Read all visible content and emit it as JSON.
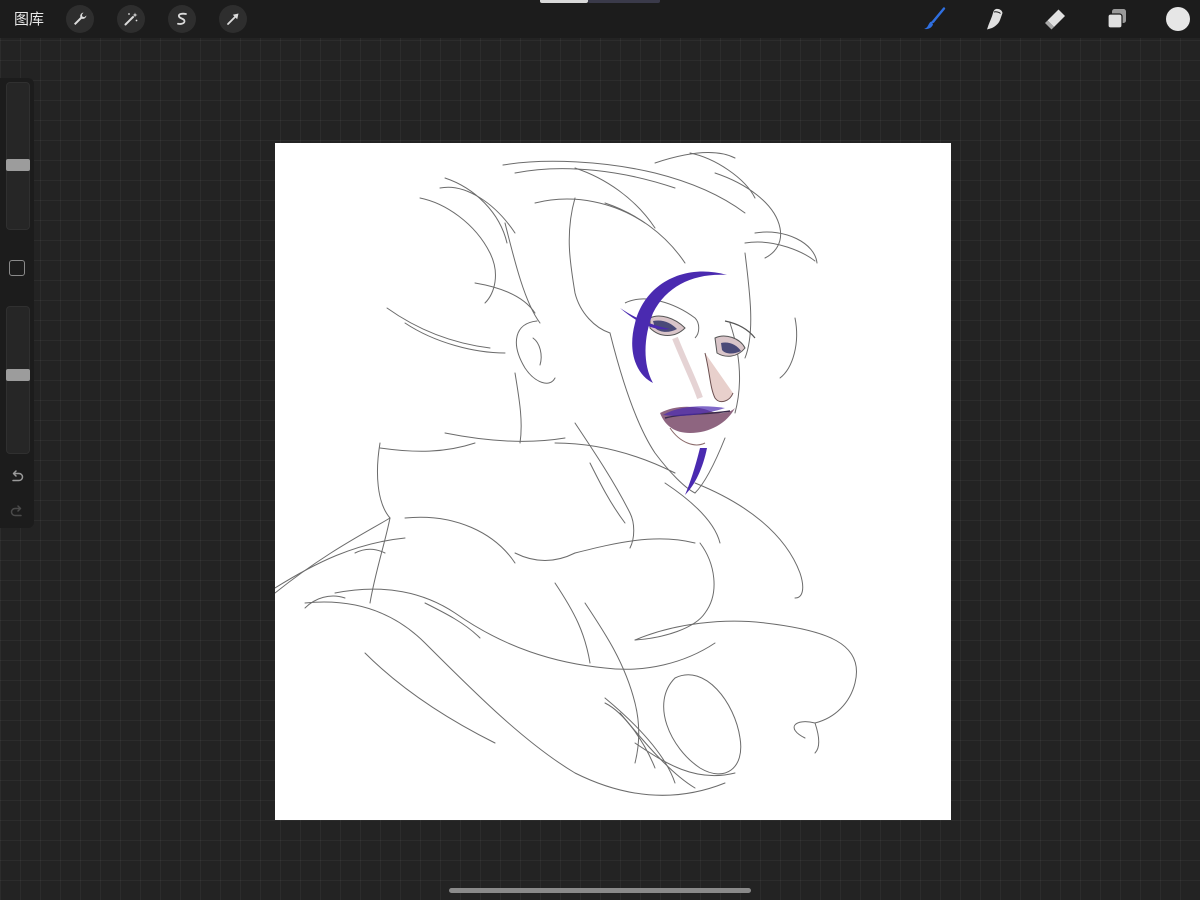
{
  "topbar": {
    "gallery_label": "图库",
    "left_tools": [
      {
        "name": "actions",
        "icon": "wrench-icon"
      },
      {
        "name": "adjustments",
        "icon": "magic-wand-icon"
      },
      {
        "name": "selection",
        "icon": "selection-s-icon"
      },
      {
        "name": "transform",
        "icon": "arrow-cursor-icon"
      }
    ],
    "right_tools": [
      {
        "name": "brush",
        "icon": "brush-icon",
        "active": true
      },
      {
        "name": "smudge",
        "icon": "smudge-finger-icon",
        "active": false
      },
      {
        "name": "eraser",
        "icon": "eraser-icon",
        "active": false
      },
      {
        "name": "layers",
        "icon": "layers-icon",
        "active": false
      }
    ],
    "current_color": "#e6e6e6",
    "active_tool_color": "#2f6fe0"
  },
  "sidebar": {
    "brush_size_level": 0.57,
    "brush_opacity_level": 0.46,
    "modify_button": "square-icon",
    "undo_icon": "undo-icon",
    "redo_icon": "redo-icon"
  },
  "canvas": {
    "background": "#ffffff",
    "sketch_line_color": "#6b6b6b",
    "face_paint_color": "#4a2ab0",
    "lip_color": "#5a3a8a"
  }
}
